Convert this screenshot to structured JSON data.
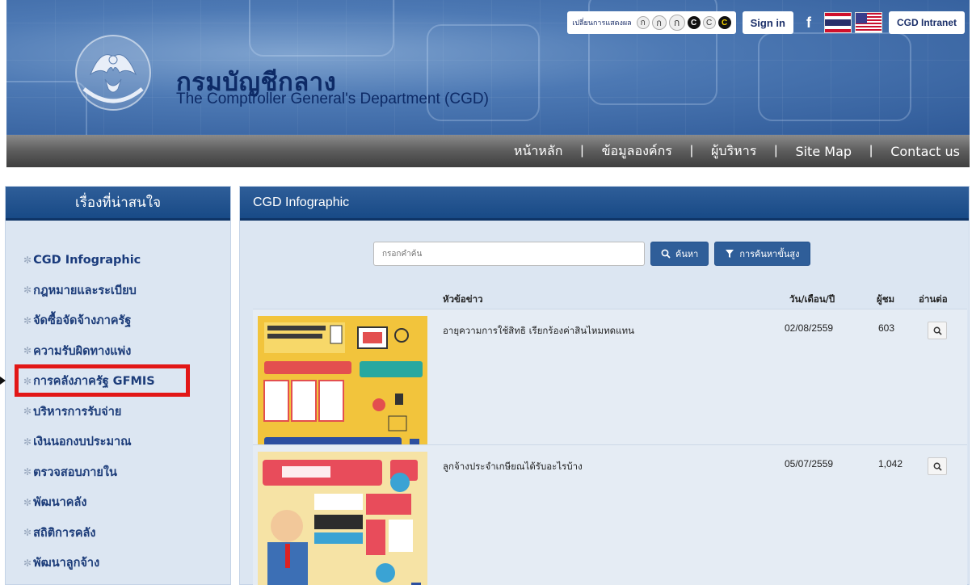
{
  "header": {
    "brand_thai": "กรมบัญชีกลาง",
    "brand_en": "The Comptroller General's Department (CGD)",
    "display_switch_label": "เปลี่ยนการแสดงผล",
    "display_options": [
      "ก",
      "ก",
      "ก",
      "C",
      "C",
      "C"
    ],
    "sign_in": "Sign in",
    "facebook": "f",
    "intranet": "CGD Intranet"
  },
  "nav": {
    "items": [
      "หน้าหลัก",
      "ข้อมูลองค์กร",
      "ผู้บริหาร",
      "Site Map",
      "Contact us"
    ]
  },
  "sidebar": {
    "title": "เรื่องที่น่าสนใจ",
    "items": [
      "CGD Infographic",
      "กฎหมายและระเบียบ",
      "จัดซื้อจัดจ้างภาครัฐ",
      "ความรับผิดทางแพ่ง",
      "การคลังภาครัฐ GFMIS",
      "บริหารการรับจ่าย",
      "เงินนอกงบประมาณ",
      "ตรวจสอบภายใน",
      "พัฒนาคลัง",
      "สถิติการคลัง",
      "พัฒนาลูกจ้าง"
    ]
  },
  "main": {
    "title": "CGD Infographic",
    "search_placeholder": "กรอกคำค้น",
    "search_button": "ค้นหา",
    "advanced_button": "การค้นหาขั้นสูง",
    "columns": [
      "หัวข้อข่าว",
      "วัน/เดือน/ปี",
      "ผู้ชม",
      "อ่านต่อ"
    ],
    "rows": [
      {
        "title": "อายุความการใช้สิทธิ เรียกร้องค่าสินไหมทดแทน",
        "date": "02/08/2559",
        "views": "603"
      },
      {
        "title": "ลูกจ้างประจำเกษียณได้รับอะไรบ้าง",
        "date": "05/07/2559",
        "views": "1,042"
      }
    ]
  },
  "colors": {
    "nav_dark": "#4a4a4a",
    "panel_header": "#1f4f8c",
    "highlight": "#e21717"
  }
}
